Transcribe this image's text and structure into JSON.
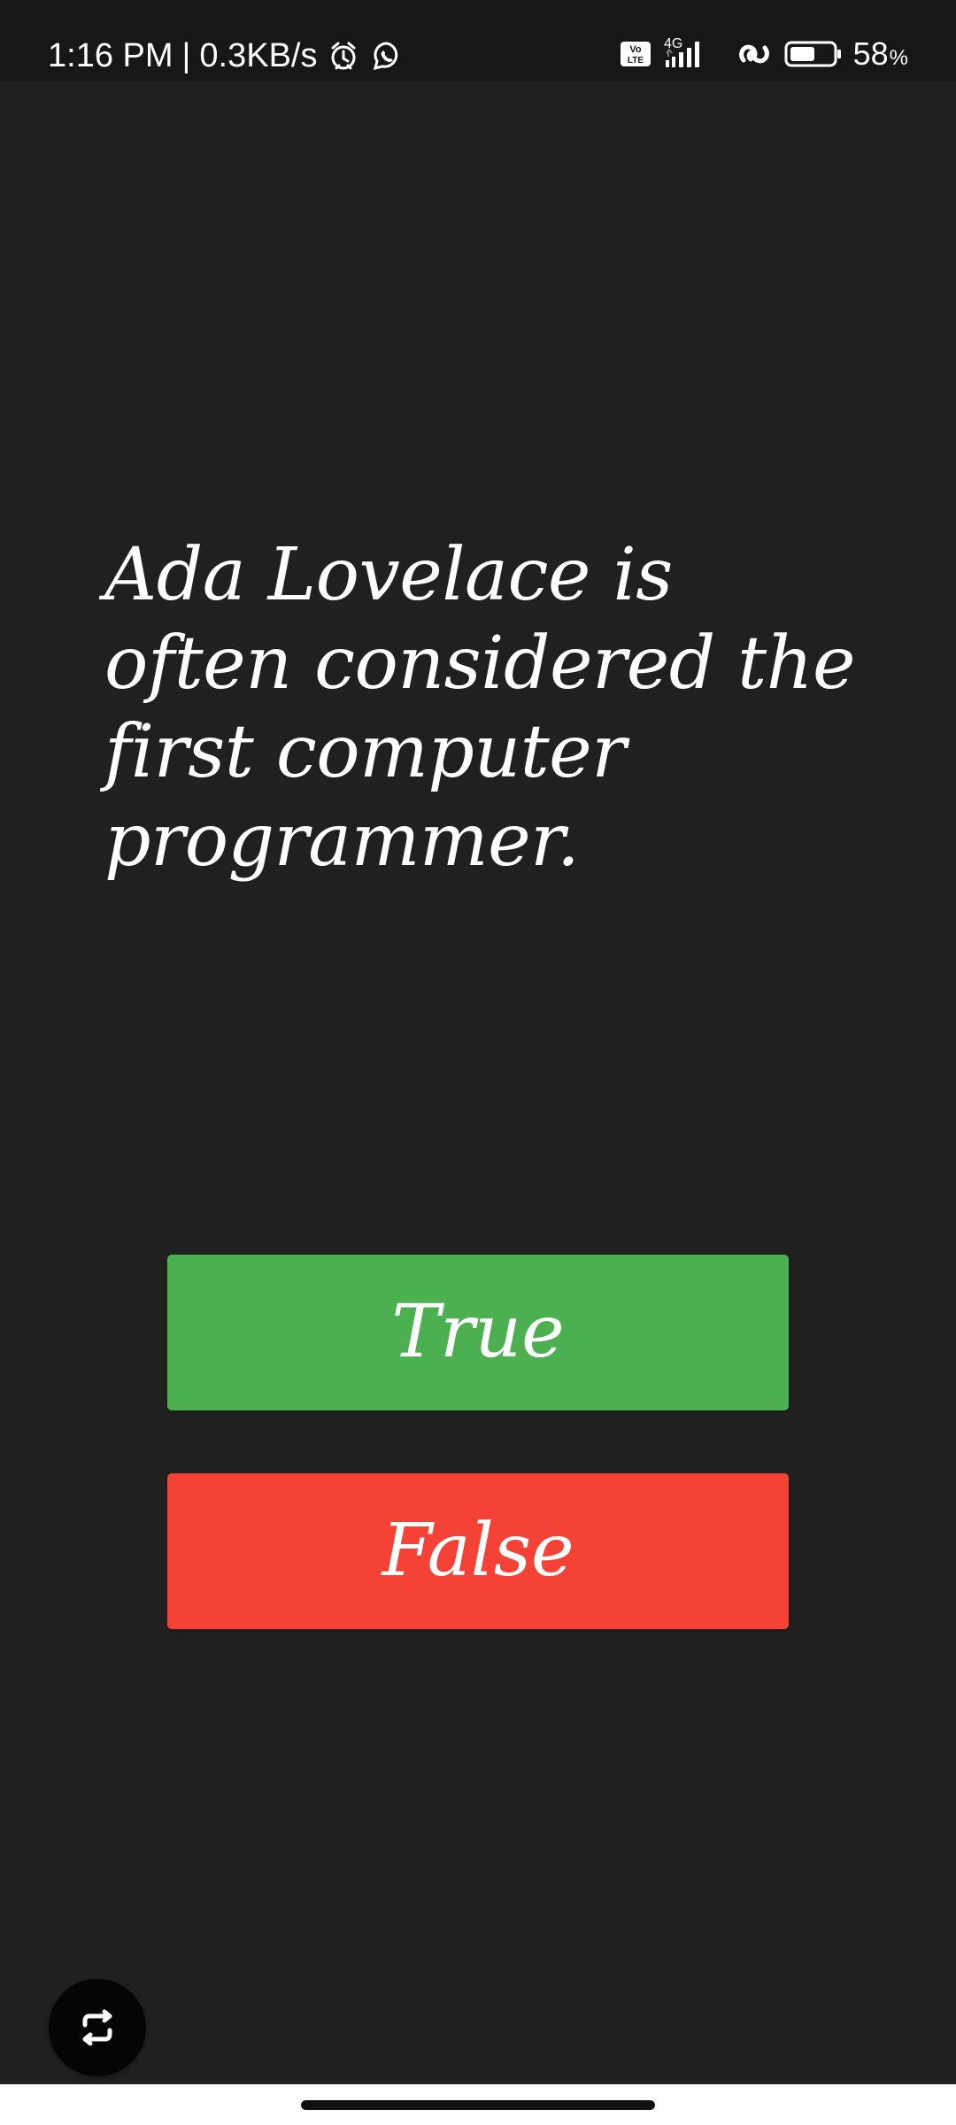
{
  "status_bar": {
    "time": "1:16 PM",
    "network_speed": "0.3KB/s",
    "left_separator": "|",
    "alarm_icon": "alarm-clock-icon",
    "whatsapp_icon": "whatsapp-icon",
    "volte_icon": "volte-icon",
    "network_type": "4G",
    "signal_icon": "signal-bars-icon",
    "wifi_icon": "hotspot-link-icon",
    "battery_icon": "battery-icon",
    "battery_percent": "58",
    "battery_suffix": "%",
    "battery_level": 0.58
  },
  "quiz": {
    "question": "Ada Lovelace is often considered the first computer programmer.",
    "true_label": "True",
    "false_label": "False"
  },
  "controls": {
    "next_icon": "repeat-icon"
  },
  "colors": {
    "background": "#202020",
    "status_bar": "#171717",
    "true_button": "#4caf50",
    "false_button": "#f44336",
    "fab": "#050505",
    "text": "#ffffff"
  }
}
